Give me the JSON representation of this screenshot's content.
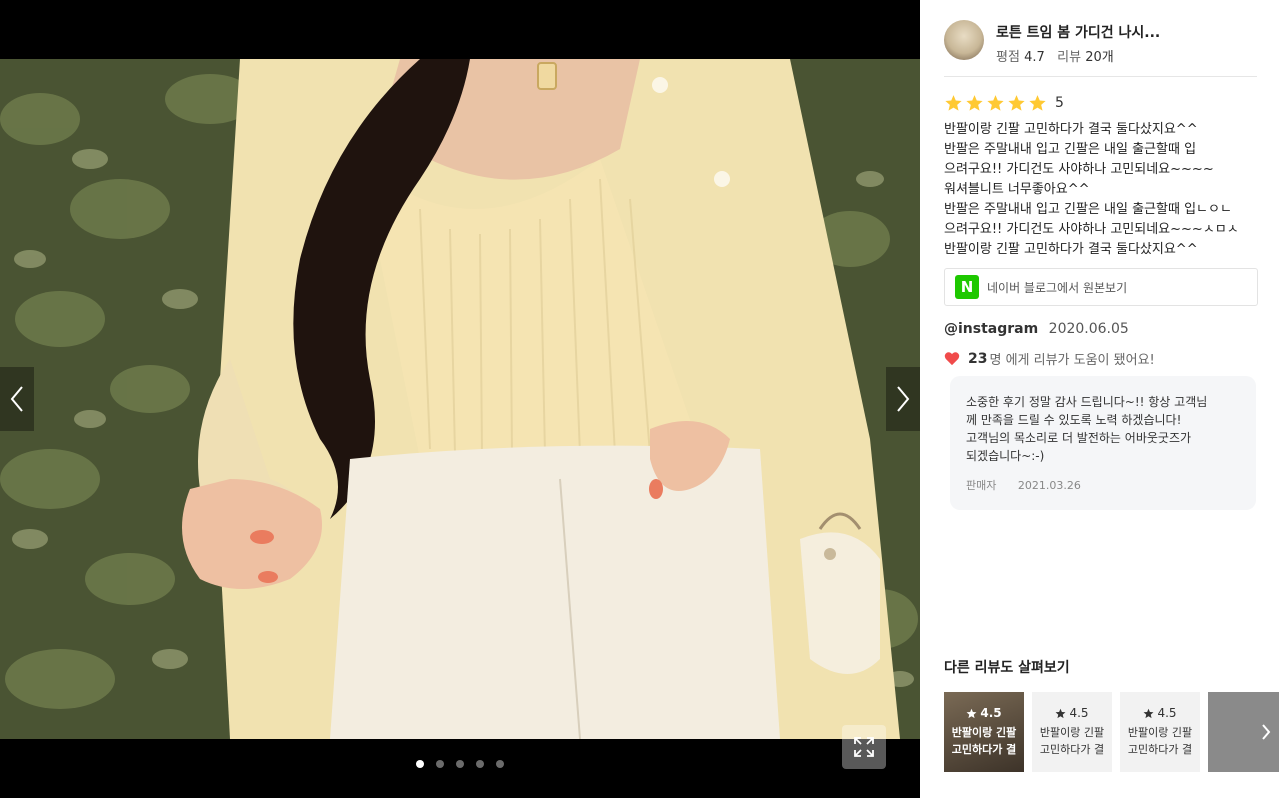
{
  "viewer": {
    "prev_label": "이전",
    "next_label": "다음",
    "dots": [
      true,
      false,
      false,
      false,
      false
    ]
  },
  "product": {
    "name": "로튼 트임 봄 가디건 나시...",
    "rating_label": "평점",
    "rating": "4.7",
    "review_label": "리뷰",
    "review_count": "20개"
  },
  "review": {
    "stars": 5,
    "score": "5",
    "lines": [
      "반팔이랑 긴팔 고민하다가 결국 둘다샀지요^^",
      "반팔은 주말내내 입고 긴팔은 내일 출근할때 입",
      "으려구요!! 가디건도 사야하나 고민되네요~~~~",
      "워셔블니트 너무좋아요^^",
      "반팔은 주말내내 입고 긴팔은 내일 출근할때 입ㄴㅇㄴ",
      "으려구요!! 가디건도 사야하나 고민되네요~~~ㅅㅁㅅ",
      "반팔이랑 긴팔 고민하다가 결국 둘다샀지요^^"
    ],
    "blog_logo": "N",
    "blog_link": "네이버 블로그에서 원본보기",
    "author": "@instagram",
    "date": "2020.06.05",
    "helpful_count": "23",
    "helpful_text": "명 에게 리뷰가 도움이 됐어요!"
  },
  "reply": {
    "lines": [
      "소중한 후기 정말 감사 드립니다~!! 항상 고객님",
      "께 만족을 드릴 수 있도록 노력 하겠습니다!",
      "고객님의 목소리로 더 발전하는 어바웃굿즈가",
      "되겠습니다~:-)"
    ],
    "author": "판매자",
    "date": "2021.03.26"
  },
  "more": {
    "title": "다른 리뷰도 살펴보기",
    "cards": [
      {
        "rating": "4.5",
        "line1": "반팔이랑 긴팔",
        "line2": "고민하다가 결"
      },
      {
        "rating": "4.5",
        "line1": "반팔이랑 긴팔",
        "line2": "고민하다가 결"
      },
      {
        "rating": "4.5",
        "line1": "반팔이랑 긴팔",
        "line2": "고민하다가 결"
      }
    ]
  },
  "colors": {
    "star": "#ffc933",
    "heart": "#f04b4b",
    "naver": "#1ec800"
  }
}
